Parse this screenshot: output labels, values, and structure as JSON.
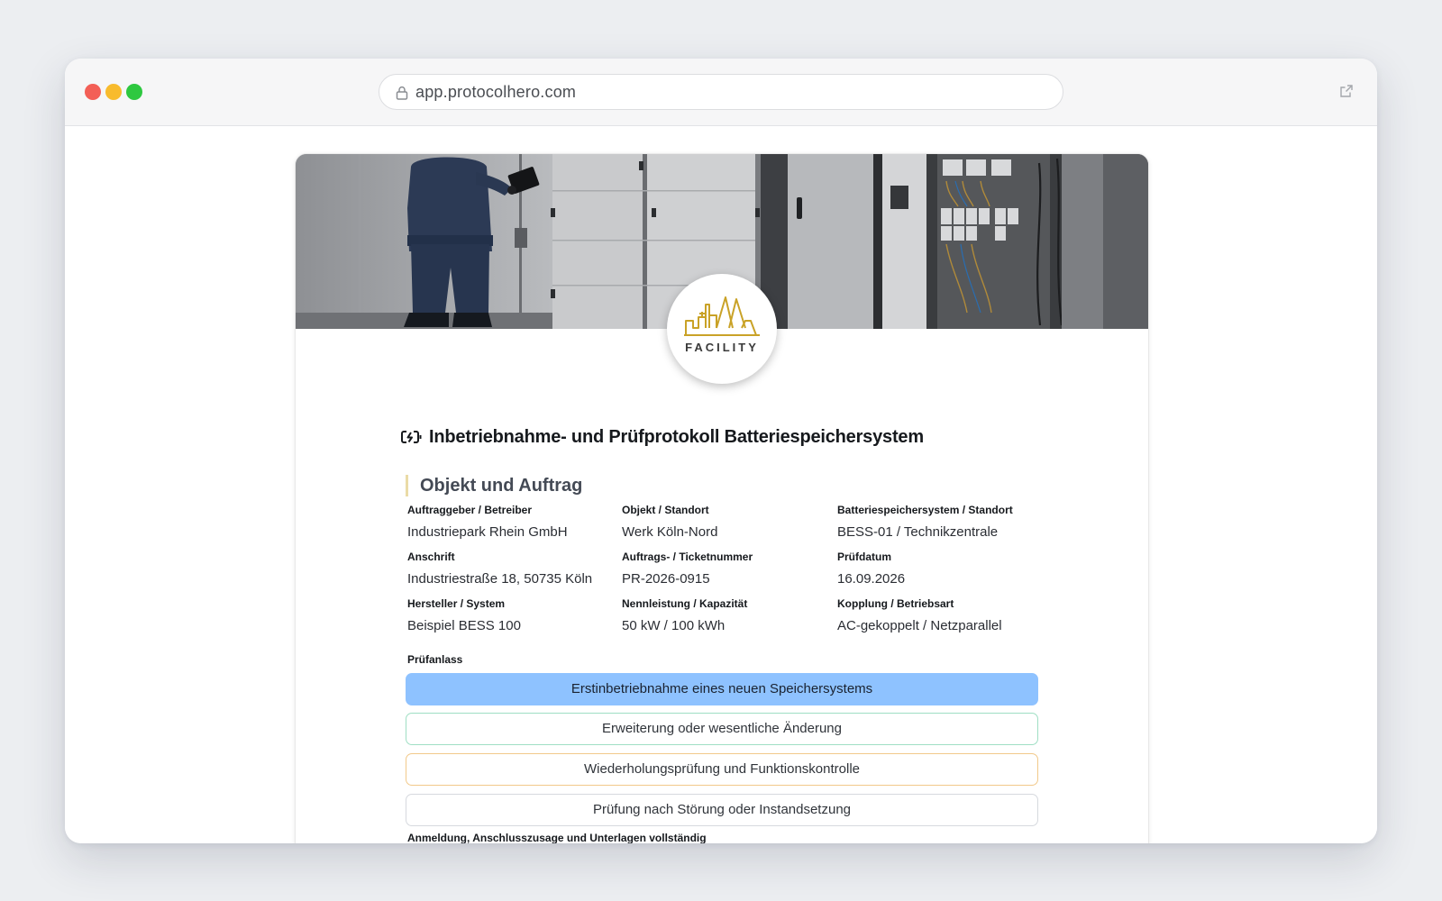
{
  "browser": {
    "url": "app.protocolhero.com"
  },
  "logo": {
    "text": "FACILITY"
  },
  "document": {
    "title": "Inbetriebnahme- und Prüfprotokoll Batteriespeichersystem"
  },
  "section": {
    "title": "Objekt und Auftrag",
    "fields": [
      {
        "label": "Auftraggeber / Betreiber",
        "value": "Industriepark Rhein GmbH"
      },
      {
        "label": "Objekt / Standort",
        "value": "Werk Köln-Nord"
      },
      {
        "label": "Batteriespeichersystem / Standort",
        "value": "BESS-01 / Technikzentrale"
      },
      {
        "label": "Anschrift",
        "value": "Industriestraße 18, 50735 Köln"
      },
      {
        "label": "Auftrags- / Ticketnummer",
        "value": "PR-2026-0915"
      },
      {
        "label": "Prüfdatum",
        "value": "16.09.2026"
      },
      {
        "label": "Hersteller / System",
        "value": "Beispiel BESS 100"
      },
      {
        "label": "Nennleistung / Kapazität",
        "value": "50 kW / 100 kWh"
      },
      {
        "label": "Kopplung / Betriebsart",
        "value": "AC-gekoppelt / Netzparallel"
      }
    ],
    "pruefanlass": {
      "label": "Prüfanlass",
      "options": [
        {
          "label": "Erstinbetriebnahme eines neuen Speichersystems",
          "selected": true
        },
        {
          "label": "Erweiterung oder wesentliche Änderung",
          "selected": false
        },
        {
          "label": "Wiederholungsprüfung und Funktionskontrolle",
          "selected": false
        },
        {
          "label": "Prüfung nach Störung oder Instandsetzung",
          "selected": false
        }
      ]
    },
    "next_label": "Anmeldung, Anschlusszusage und Unterlagen vollständig"
  },
  "colors": {
    "selected_option": "#8ec2ff",
    "section_accent": "#eadba7",
    "logo_gold": "#c9a227"
  }
}
